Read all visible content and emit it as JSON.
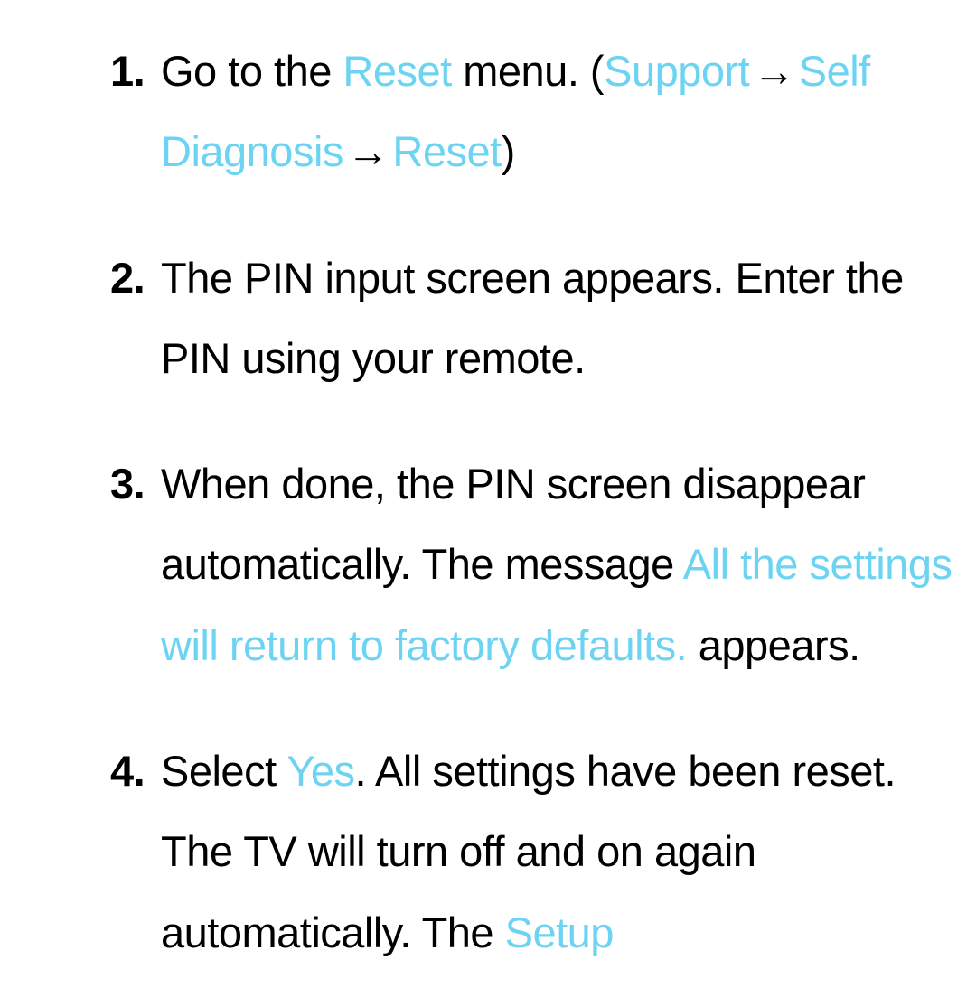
{
  "accent": "#6cd4f2",
  "arrow": "→",
  "steps": {
    "1": {
      "t1": "Go to the ",
      "reset1": "Reset",
      "t2": " menu. (",
      "support": "Support",
      "selfdiag": "Self Diagnosis",
      "reset2": "Reset",
      "t3": ")"
    },
    "2": {
      "text": "The PIN input screen appears. Enter the PIN using your remote."
    },
    "3": {
      "t1": "When done, the PIN screen disappear automatically. The message ",
      "msg": "All the settings will return to factory defaults.",
      "t2": " appears."
    },
    "4": {
      "t1": "Select ",
      "yes": "Yes",
      "t2": ". All settings have been reset. The TV will turn off and on again automatically. The ",
      "setup": "Setup"
    }
  }
}
